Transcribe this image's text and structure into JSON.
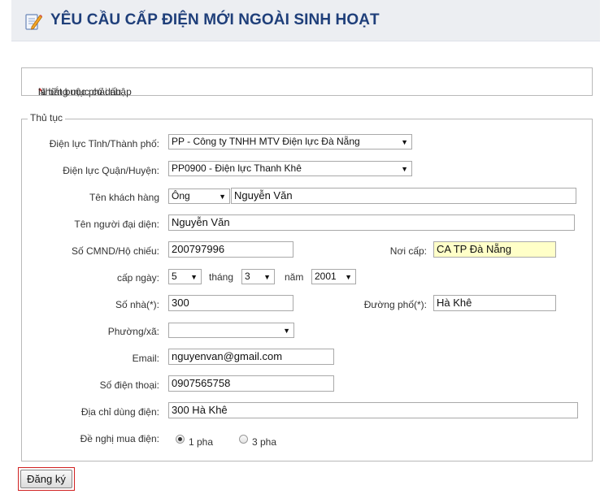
{
  "page": {
    "title": "YÊU CẦU CẤP ĐIỆN MỚI NGOÀI SINH HOẠT",
    "icon": "edit-form-icon"
  },
  "notice": {
    "prefix": "Những mục có dấu",
    "star": "*",
    "suffix": "là bắt buộc phải nhập"
  },
  "section": {
    "legend": "Thủ tục"
  },
  "form": {
    "province_label": "Điện lực Tỉnh/Thành phố:",
    "province_value": "PP - Công ty TNHH MTV Điện lực Đà Nẵng",
    "district_label": "Điện lực Quận/Huyện:",
    "district_value": "PP0900 - Điện lực Thanh Khê",
    "customer_label": "Tên khách hàng",
    "customer_title": "Ông",
    "customer_name": "Nguyễn Văn",
    "rep_label": "Tên người đại diện:",
    "rep_value": "Nguyễn Văn",
    "id_label": "Số CMND/Hộ chiếu:",
    "id_value": "200797996",
    "issue_place_label": "Nơi cấp:",
    "issue_place_value": "CA TP Đà Nẵng",
    "issue_date_label": "cấp ngày:",
    "day_value": "5",
    "month_label": "tháng",
    "month_value": "3",
    "year_label": "năm",
    "year_value": "2001",
    "house_label": "Số nhà(*):",
    "house_value": "300",
    "street_label": "Đường phố(*):",
    "street_value": "Hà Khê",
    "ward_label": "Phường/xã:",
    "ward_value": "",
    "email_label": "Email:",
    "email_value": "nguyenvan@gmail.com",
    "phone_label": "Số điện thoại:",
    "phone_value": "0907565758",
    "address_label": "Địa chỉ dùng điện:",
    "address_value": "300 Hà Khê",
    "phase_label": "Đề nghị mua điện:",
    "phase_options": [
      "1 pha",
      "3 pha"
    ],
    "phase_selected": "1 pha"
  },
  "submit_label": "Đăng ký"
}
